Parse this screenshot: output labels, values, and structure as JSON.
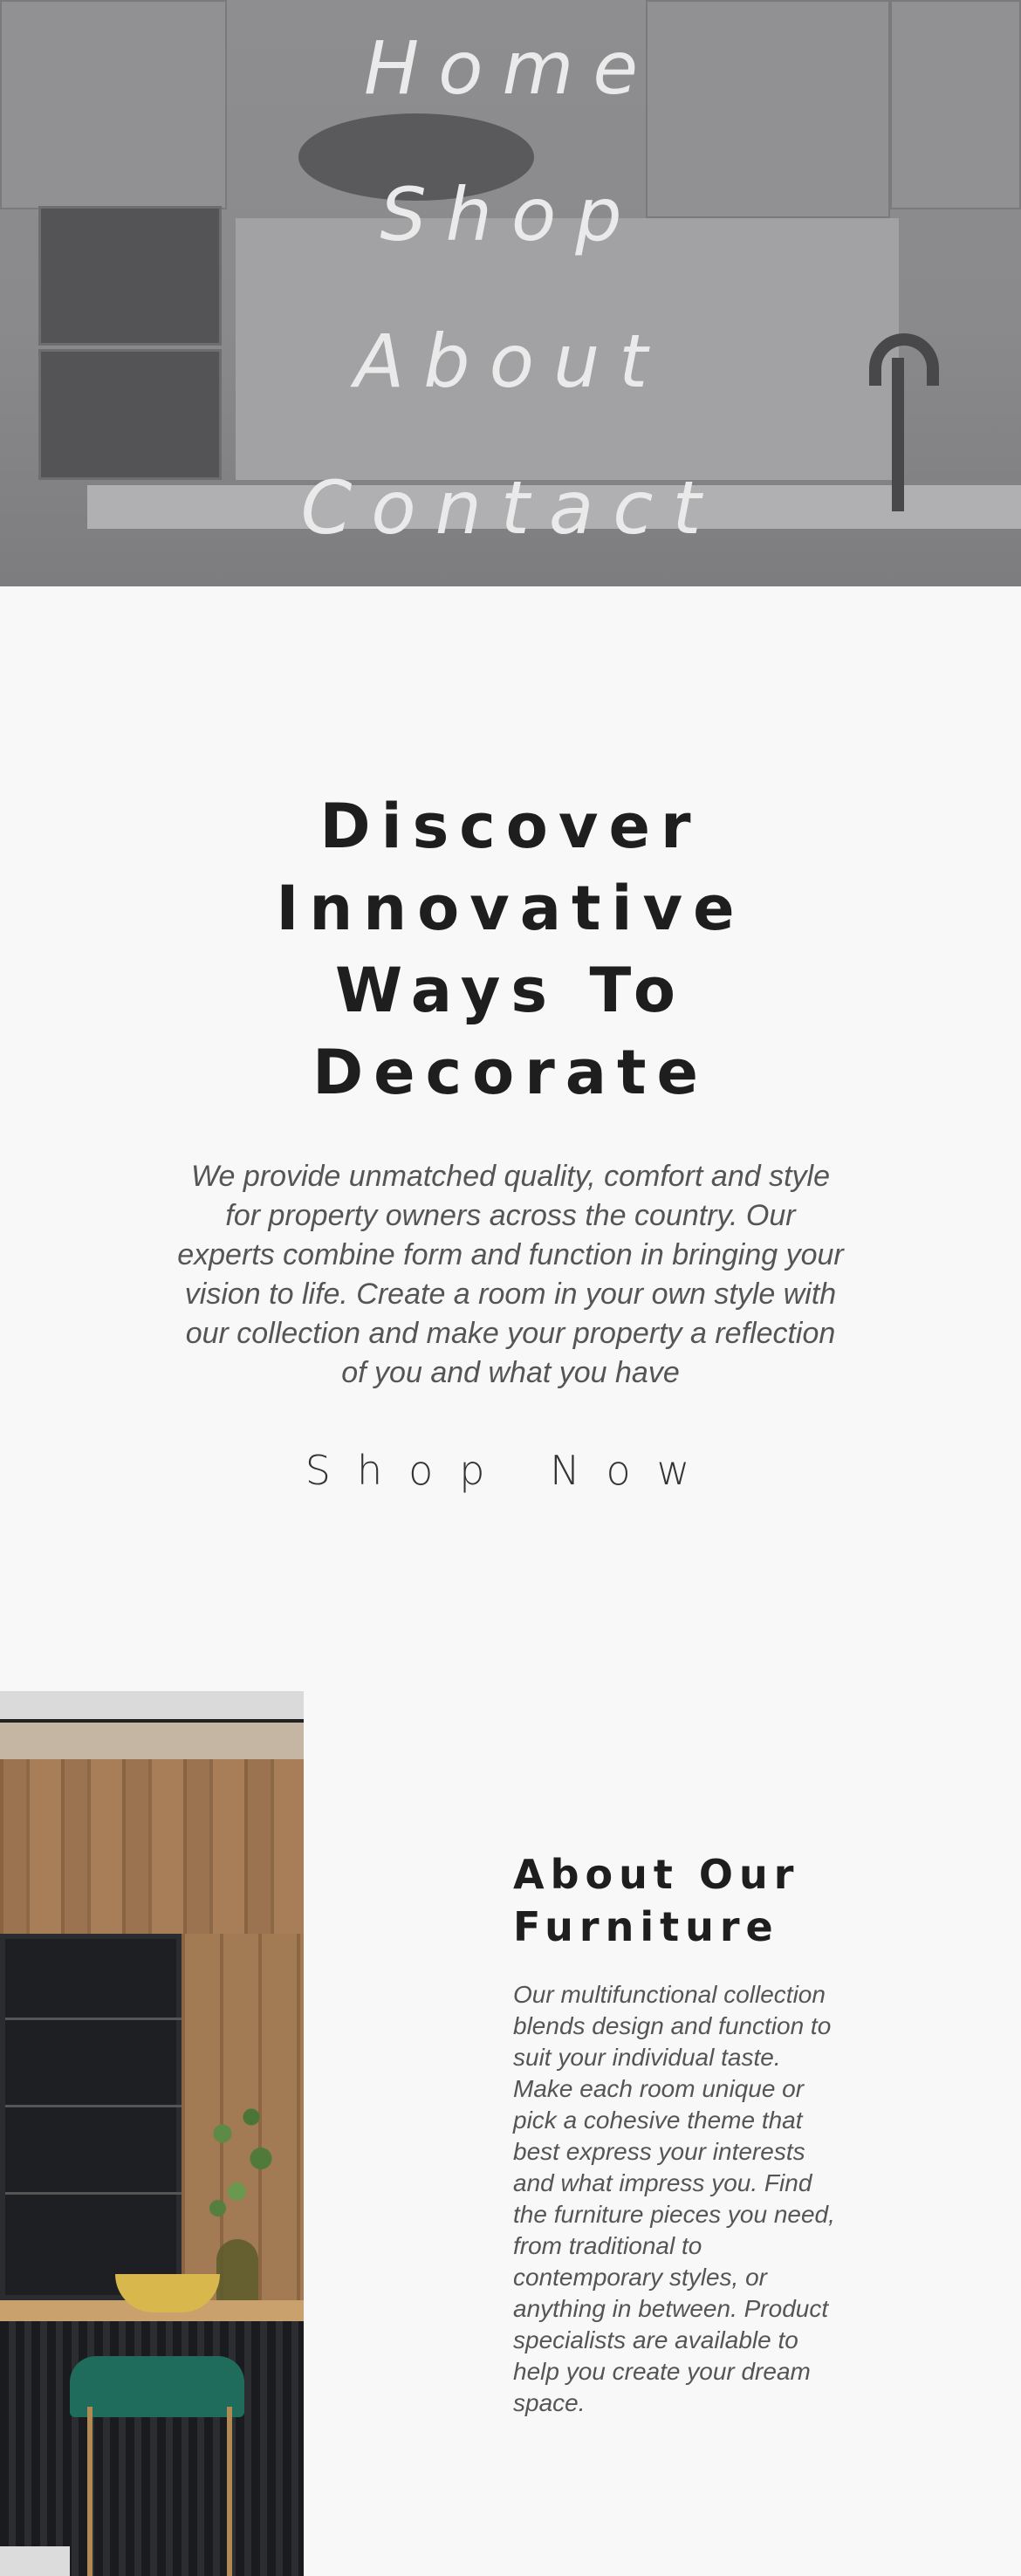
{
  "nav": {
    "items": [
      {
        "label": "Home"
      },
      {
        "label": "Shop"
      },
      {
        "label": "About"
      },
      {
        "label": "Contact"
      }
    ]
  },
  "intro": {
    "title_lines": [
      "Discover",
      "Innovative",
      "Ways To",
      "Decorate"
    ],
    "text_lines": [
      "We provide unmatched quality, comfort and style",
      "for property owners across the country. Our",
      "experts combine form and function in bringing your",
      "vision to life. Create a room in your own style with",
      "our collection and make your property a reflection",
      "of you and what you have"
    ],
    "cta_label": "Shop Now"
  },
  "about": {
    "title_lines": [
      "About Our",
      "Furniture"
    ],
    "text_lines": [
      "Our multifunctional collection",
      "blends design and function to",
      "suit your individual taste.",
      "Make each room unique or",
      "pick a cohesive theme that",
      "best express your interests",
      "and what impress you. Find",
      "the furniture pieces you need,",
      "from traditional to",
      "contemporary styles, or",
      "anything in between. Product",
      "specialists are available to",
      "help you create your dream",
      "space."
    ]
  }
}
